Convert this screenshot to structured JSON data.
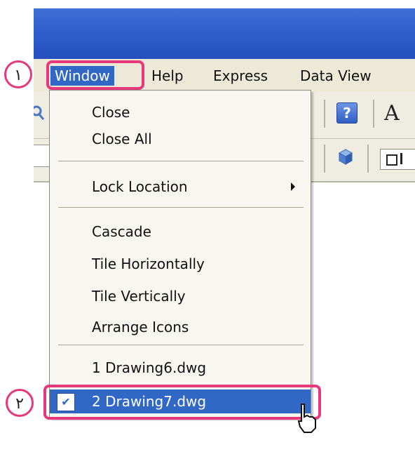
{
  "menubar": {
    "items": [
      {
        "label": "Window",
        "active": true
      },
      {
        "label": "Help"
      },
      {
        "label": "Express"
      },
      {
        "label": "Data View"
      }
    ]
  },
  "toolbar": {
    "help_glyph": "?",
    "letter_glyph": "A",
    "icons": [
      "magnifier-icon",
      "help-icon",
      "cube-icon",
      "checkbox-icon"
    ]
  },
  "window_menu": {
    "items": [
      {
        "label": "Close"
      },
      {
        "label": "Close All"
      },
      {
        "label": "Lock Location",
        "submenu": true
      },
      {
        "label": "Cascade"
      },
      {
        "label": "Tile Horizontally"
      },
      {
        "label": "Tile Vertically"
      },
      {
        "label": "Arrange Icons"
      },
      {
        "label": "1 Drawing6.dwg"
      },
      {
        "label": "2 Drawing7.dwg",
        "checked": true,
        "selected": true
      }
    ]
  },
  "annotations": {
    "step1": "١",
    "step2": "٢"
  },
  "colors": {
    "highlight": "#3167c5",
    "annotation": "#e6397c",
    "titlebar": "#2d5cc9"
  }
}
